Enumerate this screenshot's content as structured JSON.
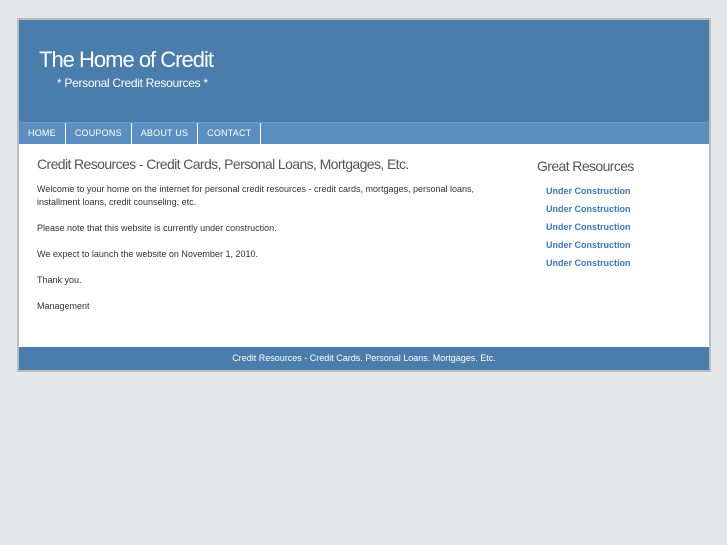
{
  "header": {
    "title": "The Home of Credit",
    "tagline": "* Personal Credit Resources *"
  },
  "nav": {
    "items": [
      {
        "label": "HOME"
      },
      {
        "label": "COUPONS"
      },
      {
        "label": "ABOUT US"
      },
      {
        "label": "CONTACT"
      }
    ]
  },
  "main": {
    "heading": "Credit Resources - Credit Cards, Personal Loans, Mortgages, Etc.",
    "paragraphs": [
      "Welcome to your home on the internet for personal credit resources - credit cards, mortgages, personal loans, installment loans, credit counseling, etc.",
      "Please note that this website is currently under construction.",
      "We expect to launch the website on November 1, 2010.",
      "Thank you.",
      "Management"
    ]
  },
  "sidebar": {
    "heading": "Great Resources",
    "links": [
      {
        "label": "Under Construction"
      },
      {
        "label": "Under Construction"
      },
      {
        "label": "Under Construction"
      },
      {
        "label": "Under Construction"
      },
      {
        "label": "Under Construction"
      }
    ]
  },
  "footer": {
    "text": "Credit Resources - Credit Cards. Personal Loans. Mortgages. Etc."
  },
  "colors": {
    "header_bg": "#4a7dac",
    "nav_bg": "#5c8fbf",
    "link": "#3d7ab8",
    "page_bg": "#e6e7e8"
  }
}
